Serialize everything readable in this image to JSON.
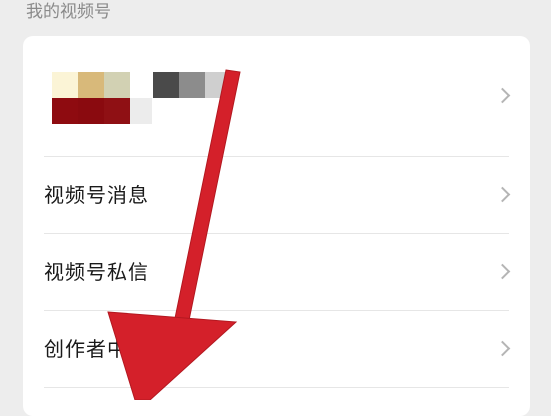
{
  "section": {
    "title": "我的视频号"
  },
  "menu": {
    "items": [
      {
        "label": "视频号消息"
      },
      {
        "label": "视频号私信"
      },
      {
        "label": "创作者中心"
      }
    ]
  },
  "colors": {
    "background": "#ededed",
    "card": "#ffffff",
    "arrow": "#d4202a",
    "chevron": "#b5b5b5"
  },
  "icons": {
    "row_chevron": "chevron-right-icon",
    "annotation": "red-arrow-annotation"
  }
}
